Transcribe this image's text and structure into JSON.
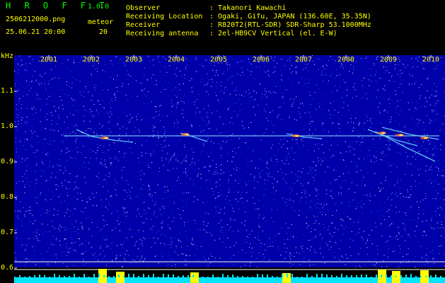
{
  "header": {
    "app_title": "H R O F F T",
    "version": "1.0.0",
    "filename": "2506212000.png",
    "datetime": "25.06.21 20:00",
    "meteor_label": "meteor",
    "meteor_count": "20",
    "info_labels": [
      "Observer",
      "Receiving Location",
      "Receiver",
      "Receiving antenna"
    ],
    "info_values": [
      ": Takanori Kawachi",
      ": Ogaki, Gifu, JAPAN (136.60E, 35.35N)",
      ": R820T2(RTL-SDR) SDR-Sharp 53.1000MHz",
      ": 2el-HB9CV Vertical (el. E-W)"
    ]
  },
  "waterfall": {
    "unit_label": "kHz",
    "y_ticks": [
      "1.1",
      "1.0",
      "0.9",
      "0.8",
      "0.7",
      "0.6"
    ],
    "x_ticks": [
      "2001",
      "2002",
      "2003",
      "2004",
      "2005",
      "2006",
      "2007",
      "2008",
      "2009",
      "2010"
    ],
    "colors": {
      "label": "#ffff00",
      "title": "#00ff00",
      "background": "#000000",
      "noise": "#0000aa",
      "power_bar": "#00e5ff",
      "peak": "#ffff00"
    }
  }
}
